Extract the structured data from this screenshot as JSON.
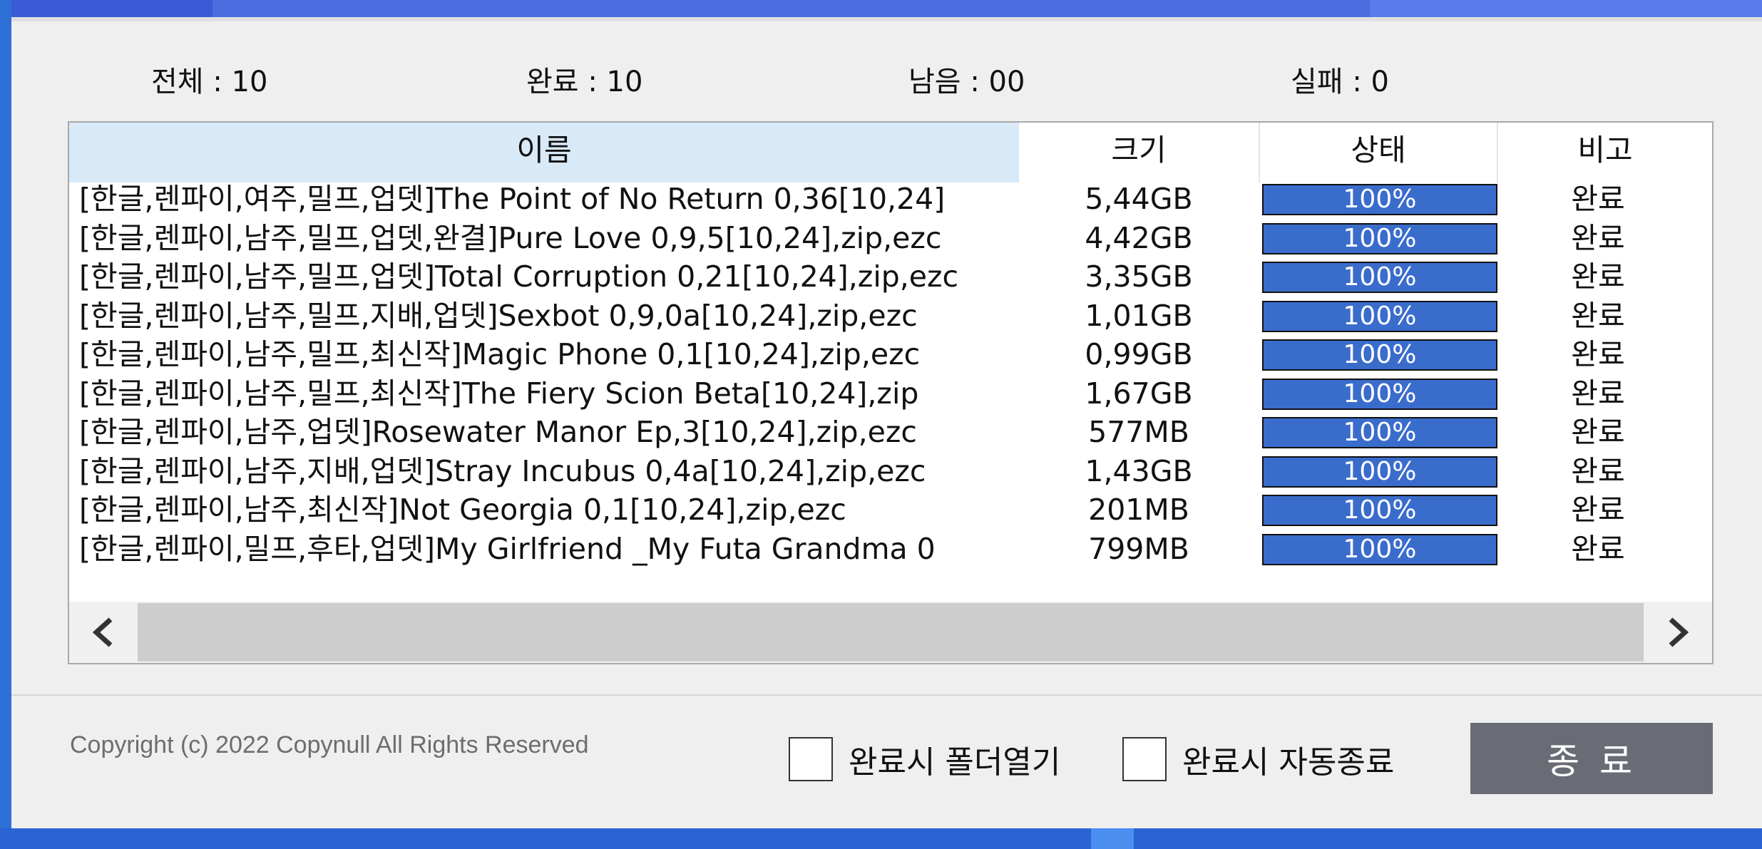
{
  "titlebar": {
    "progress": 0.115
  },
  "stats": {
    "total": "전체 : 10",
    "done": "완료 : 10",
    "remaining": "남음 : 00",
    "failed": "실패 : 0"
  },
  "table": {
    "columns": {
      "name": "이름",
      "size": "크기",
      "status": "상태",
      "note": "비고"
    },
    "rows": [
      {
        "name": "[한글,렌파이,여주,밀프,업뎃]The Point of No Return 0,36[10,24]",
        "size": "5,44GB",
        "progress": 1.0,
        "progress_text": "100%",
        "note": "완료"
      },
      {
        "name": "[한글,렌파이,남주,밀프,업뎃,완결]Pure Love 0,9,5[10,24],zip,ezc",
        "size": "4,42GB",
        "progress": 1.0,
        "progress_text": "100%",
        "note": "완료"
      },
      {
        "name": "[한글,렌파이,남주,밀프,업뎃]Total Corruption 0,21[10,24],zip,ezc",
        "size": "3,35GB",
        "progress": 1.0,
        "progress_text": "100%",
        "note": "완료"
      },
      {
        "name": "[한글,렌파이,남주,밀프,지배,업뎃]Sexbot 0,9,0a[10,24],zip,ezc",
        "size": "1,01GB",
        "progress": 1.0,
        "progress_text": "100%",
        "note": "완료"
      },
      {
        "name": "[한글,렌파이,남주,밀프,최신작]Magic Phone 0,1[10,24],zip,ezc",
        "size": "0,99GB",
        "progress": 1.0,
        "progress_text": "100%",
        "note": "완료"
      },
      {
        "name": "[한글,렌파이,남주,밀프,최신작]The Fiery Scion Beta[10,24],zip",
        "size": "1,67GB",
        "progress": 1.0,
        "progress_text": "100%",
        "note": "완료"
      },
      {
        "name": "[한글,렌파이,남주,업뎃]Rosewater Manor Ep,3[10,24],zip,ezc",
        "size": "577MB",
        "progress": 1.0,
        "progress_text": "100%",
        "note": "완료"
      },
      {
        "name": "[한글,렌파이,남주,지배,업뎃]Stray Incubus 0,4a[10,24],zip,ezc",
        "size": "1,43GB",
        "progress": 1.0,
        "progress_text": "100%",
        "note": "완료"
      },
      {
        "name": "[한글,렌파이,남주,최신작]Not Georgia 0,1[10,24],zip,ezc",
        "size": "201MB",
        "progress": 1.0,
        "progress_text": "100%",
        "note": "완료"
      },
      {
        "name": "[한글,렌파이,밀프,후타,업뎃]My Girlfriend _My Futa Grandma 0",
        "size": "799MB",
        "progress": 1.0,
        "progress_text": "100%",
        "note": "완료"
      }
    ]
  },
  "icons": {
    "scroll_left": "chevron-left-icon",
    "scroll_right": "chevron-right-icon",
    "checkbox": "checkbox-empty"
  },
  "colors": {
    "progress_fill": "#3a6ccc",
    "header_selected": "#d8e9f7",
    "close_button": "#6a6c75"
  },
  "footer": {
    "copyright": "Copyright (c) 2022 Copynull All Rights Reserved",
    "open_folder_label": "완료시 폴더열기",
    "open_folder_checked": false,
    "auto_exit_label": "완료시 자동종료",
    "auto_exit_checked": false,
    "close_button": "종 료"
  }
}
